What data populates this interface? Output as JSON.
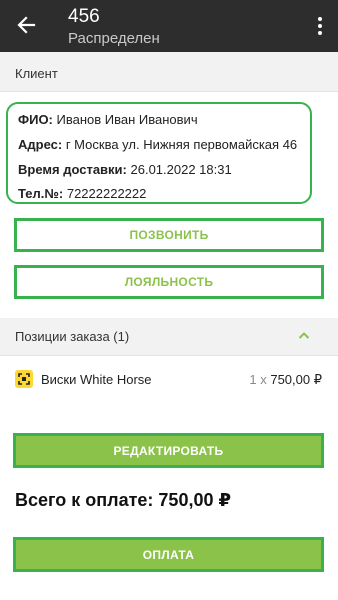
{
  "header": {
    "title": "456",
    "subtitle": "Распределен"
  },
  "client_section": {
    "label": "Клиент",
    "fio_label": "ФИО:",
    "fio_value": "Иванов Иван Иванович",
    "address_label": "Адрес:",
    "address_value": "г Москва ул. Нижняя первомайская 46",
    "delivery_label": "Время доставки:",
    "delivery_value": "26.01.2022 18:31",
    "phone_label": "Тел.№:",
    "phone_value": "72222222222"
  },
  "actions": {
    "call_label": "ПОЗВОНИТЬ",
    "loyalty_label": "ЛОЯЛЬНОСТЬ",
    "edit_label": "РЕДАКТИРОВАТЬ",
    "pay_label": "ОПЛАТА"
  },
  "order_section": {
    "label": "Позиции заказа (1)",
    "items": [
      {
        "name": "Виски White Horse",
        "qty": "1",
        "mult": "x",
        "price": "750,00 ₽"
      }
    ]
  },
  "total": {
    "text": "Всего к оплате: 750,00 ₽"
  },
  "colors": {
    "accent": "#8bc34a",
    "highlight_border": "#37b24d",
    "appbar": "#2d2d2d"
  }
}
